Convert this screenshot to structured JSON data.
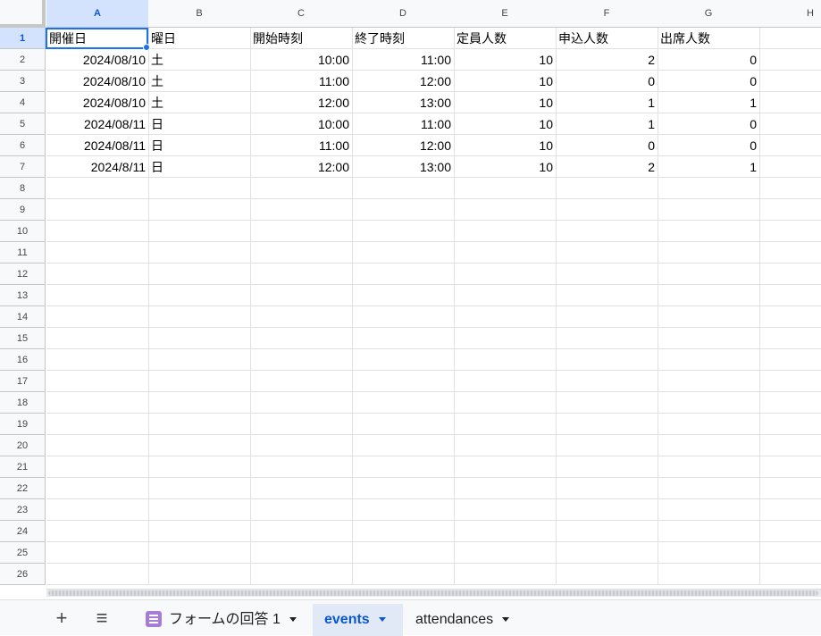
{
  "columns": [
    "A",
    "B",
    "C",
    "D",
    "E",
    "F",
    "G",
    "H"
  ],
  "rows": [
    [
      "開催日",
      "曜日",
      "開始時刻",
      "終了時刻",
      "定員人数",
      "申込人数",
      "出席人数",
      ""
    ],
    [
      "2024/08/10",
      "土",
      "10:00",
      "11:00",
      "10",
      "2",
      "0",
      ""
    ],
    [
      "2024/08/10",
      "土",
      "11:00",
      "12:00",
      "10",
      "0",
      "0",
      ""
    ],
    [
      "2024/08/10",
      "土",
      "12:00",
      "13:00",
      "10",
      "1",
      "1",
      ""
    ],
    [
      "2024/08/11",
      "日",
      "10:00",
      "11:00",
      "10",
      "1",
      "0",
      ""
    ],
    [
      "2024/08/11",
      "日",
      "11:00",
      "12:00",
      "10",
      "0",
      "0",
      ""
    ],
    [
      "2024/8/11",
      "日",
      "12:00",
      "13:00",
      "10",
      "2",
      "1",
      ""
    ]
  ],
  "row_count": 26,
  "selected_cell": "A1",
  "tabs": [
    {
      "label": "フォームの回答 1",
      "icon": "form-icon",
      "active": false
    },
    {
      "label": "events",
      "active": true
    },
    {
      "label": "attendances",
      "active": false
    }
  ],
  "toolbar": {
    "add_sheet": "+",
    "all_sheets": "≡"
  },
  "colors": {
    "selection": "#1a73e8",
    "header_selected_bg": "#d3e3fd",
    "active_tab_bg": "#e1e9f7"
  }
}
